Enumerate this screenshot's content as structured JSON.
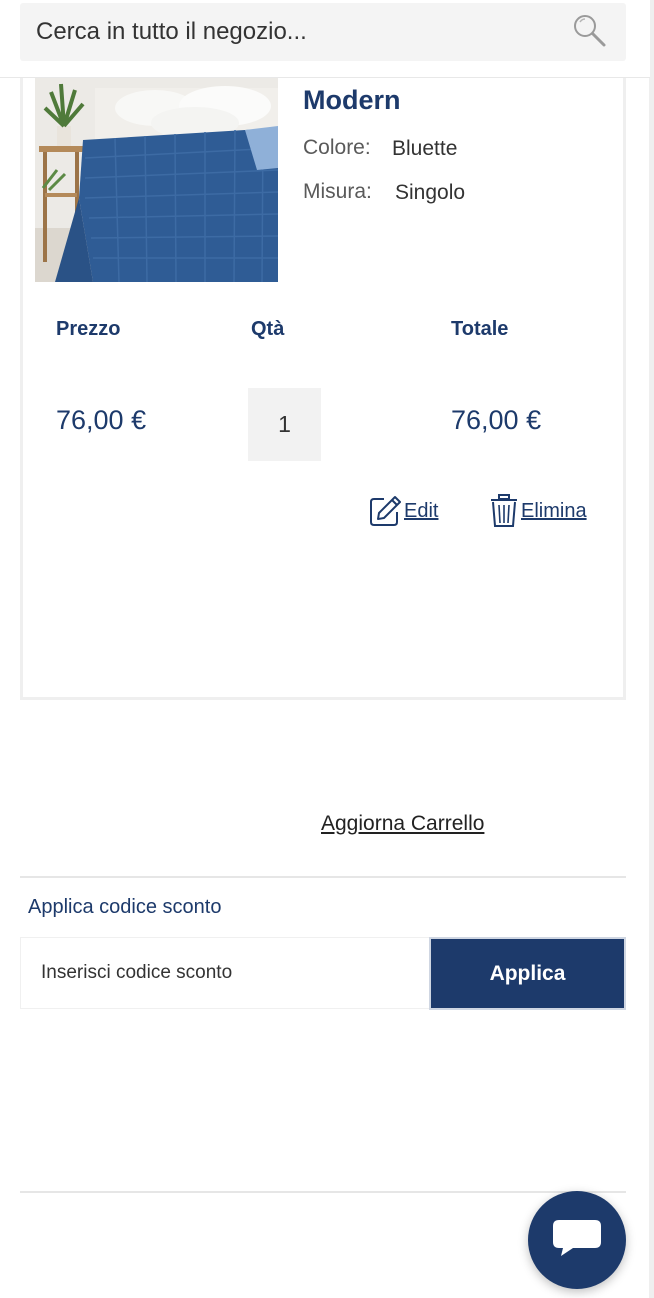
{
  "search": {
    "placeholder": "Cerca in tutto il negozio..."
  },
  "cart_item": {
    "name": "Modern",
    "image_alt": "Copriletto trapuntato blu",
    "options": [
      {
        "label": "Colore:",
        "value": "Bluette"
      },
      {
        "label": "Misura:",
        "value": "Singolo"
      }
    ],
    "columns": {
      "price": "Prezzo",
      "qty": "Qtà",
      "total": "Totale"
    },
    "price": "76,00 €",
    "qty": "1",
    "total": "76,00 €",
    "actions": {
      "edit": "Edit",
      "delete": "Elimina"
    }
  },
  "update_cart_label": "Aggiorna Carrello",
  "discount": {
    "title": "Applica codice sconto",
    "placeholder": "Inserisci codice sconto",
    "apply_label": "Applica"
  },
  "colors": {
    "brand": "#1d3a6b",
    "bg": "#ffffff",
    "field": "#f4f4f4"
  },
  "icons": [
    "search-icon",
    "edit-icon",
    "trash-icon",
    "chat-icon"
  ]
}
